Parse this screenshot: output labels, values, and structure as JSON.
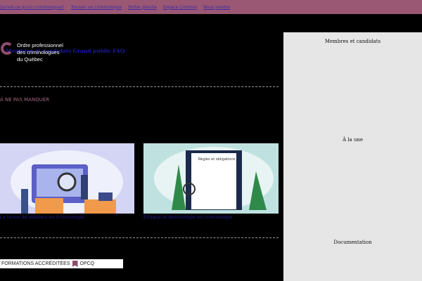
{
  "topnav": [
    "Qu'est-ce qu'un criminologue?",
    "Trouver un criminologue",
    "Porter plainte",
    "Espace Criminol",
    "Nous joindre"
  ],
  "logo": {
    "line1": "Ordre professionnel",
    "line2": "des criminologues",
    "line3": "du Québec"
  },
  "mainnav": [
    "Membres et candidats",
    "Grand public",
    "FAQ"
  ],
  "section_title": "À NE PAS MANQUER",
  "cards": [
    {
      "caption": "La tenue de dossiers en criminologie"
    },
    {
      "caption": "Éthique et déontologie en criminologie",
      "image_text": "Règles et obligations"
    }
  ],
  "badge": {
    "left": "FORMATIONS ACCRÉDITÉES",
    "right": "OPCQ"
  },
  "sidebar": [
    "Membres et candidats",
    "À la une",
    "Documentation"
  ],
  "colors": {
    "topbar": "#9b5874",
    "brand": "#8e4c6c",
    "sidebar": "#e6e6e6"
  }
}
